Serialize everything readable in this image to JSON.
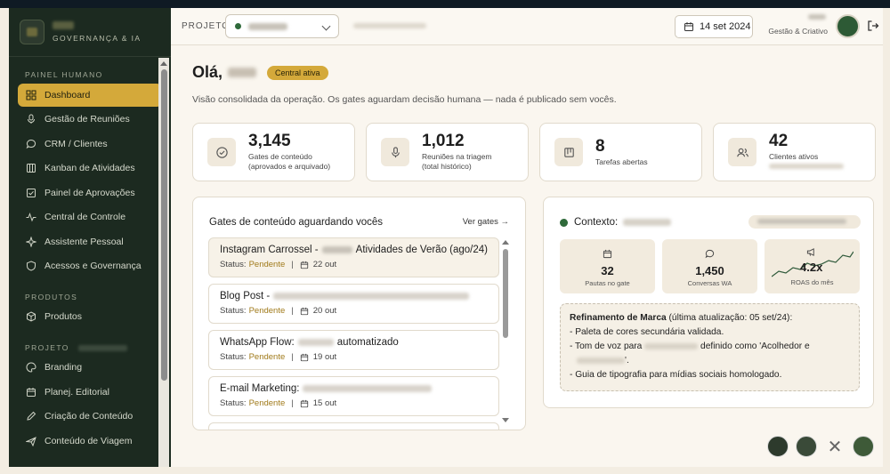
{
  "brand": {
    "subtitle": "GOVERNANÇA & IA"
  },
  "sidebar": {
    "sections": [
      {
        "title": "PAINEL HUMANO"
      },
      {
        "title": "PRODUTOS"
      },
      {
        "title": "PROJETO"
      }
    ],
    "items": [
      {
        "label": "Dashboard",
        "icon": "grid-icon",
        "active": true
      },
      {
        "label": "Gestão de Reuniões",
        "icon": "microphone-icon"
      },
      {
        "label": "CRM / Clientes",
        "icon": "chat-icon"
      },
      {
        "label": "Kanban de Atividades",
        "icon": "kanban-icon"
      },
      {
        "label": "Painel de Aprovações",
        "icon": "approval-icon"
      },
      {
        "label": "Central de Controle",
        "icon": "pulse-icon"
      },
      {
        "label": "Assistente Pessoal",
        "icon": "sparkle-icon"
      },
      {
        "label": "Acessos e Governança",
        "icon": "shield-icon"
      },
      {
        "label": "Produtos",
        "icon": "box-icon"
      },
      {
        "label": "Branding",
        "icon": "palette-icon"
      },
      {
        "label": "Planej. Editorial",
        "icon": "calendar-icon"
      },
      {
        "label": "Criação de Conteúdo",
        "icon": "edit-icon"
      },
      {
        "label": "Conteúdo de Viagem",
        "icon": "plane-icon"
      }
    ]
  },
  "header": {
    "project_label": "PROJETO",
    "date": "14 set 2024",
    "user_role": "Gestão & Criativo"
  },
  "main": {
    "greeting": "Olá,",
    "badge": "Central ativa",
    "subtitle": "Visão consolidada da operação. Os gates aguardam decisão humana — nada é publicado sem vocês.",
    "stats": [
      {
        "value": "3,145",
        "label1": "Gates de conteúdo",
        "label2": "(aprovados e arquivado)",
        "icon": "check-circle-icon"
      },
      {
        "value": "1,012",
        "label1": "Reuniões na triagem",
        "label2": "(total histórico)",
        "icon": "microphone-icon"
      },
      {
        "value": "8",
        "label1": "Tarefas abertas",
        "label2": "",
        "icon": "board-icon"
      },
      {
        "value": "42",
        "label1": "Clientes ativos",
        "label2": "",
        "icon": "users-icon"
      }
    ]
  },
  "gates": {
    "title": "Gates de conteúdo aguardando vocês",
    "link": "Ver gates →",
    "status_label": "Status:",
    "items": [
      {
        "prefix": "Instagram Carrossel -",
        "suffix": "Atividades de Verão (ago/24)",
        "status": "Pendente",
        "date": "22 out"
      },
      {
        "prefix": "Blog Post -",
        "suffix": "",
        "status": "Pendente",
        "date": "20 out"
      },
      {
        "prefix": "WhatsApp Flow:",
        "suffix": "automatizado",
        "status": "Pendente",
        "date": "19 out"
      },
      {
        "prefix": "E-mail Marketing:",
        "suffix": "",
        "status": "Pendente",
        "date": "15 out"
      }
    ]
  },
  "context": {
    "title": "Contexto:",
    "minis": [
      {
        "value": "32",
        "label": "Pautas no gate",
        "icon": "calendar-icon"
      },
      {
        "value": "1,450",
        "label": "Conversas WA",
        "icon": "chat-icon"
      }
    ],
    "roas": {
      "value": "4.2x",
      "label": "ROAS do mês",
      "icon": "megaphone-icon"
    },
    "note": {
      "title": "Refinamento de Marca",
      "title_rest": " (última atualização: 05 set/24):",
      "line1": "- Paleta de cores secundária validada.",
      "line2a": "- Tom de voz para",
      "line2b": "definido como 'Acolhedor e",
      "line3": "'.",
      "line4": "- Guia de tipografia para mídias sociais homologado."
    }
  },
  "colors": {
    "accent": "#d4a93a",
    "sidebar": "#1c2a20",
    "brand_green": "#2f6a3a"
  }
}
